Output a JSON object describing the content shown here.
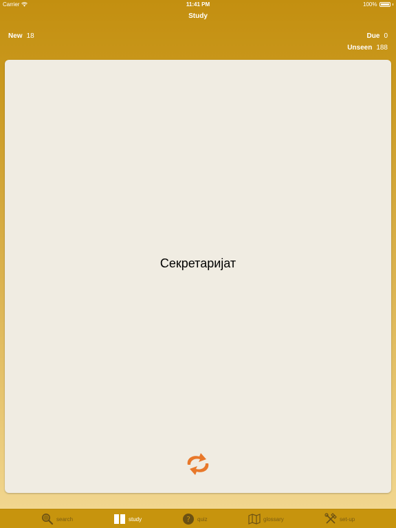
{
  "status_bar": {
    "carrier": "Carrier",
    "time": "11:41 PM",
    "battery": "100%",
    "battery_level": 1.0
  },
  "nav": {
    "title": "Study"
  },
  "stats": {
    "new_label": "New",
    "new_value": "18",
    "due_label": "Due",
    "due_value": "0",
    "unseen_label": "Unseen",
    "unseen_value": "188"
  },
  "card": {
    "word": "Секретаријат",
    "flip_icon": "refresh-icon",
    "accent": "#e8782a"
  },
  "tabs": [
    {
      "label": "search",
      "icon": "search-icon"
    },
    {
      "label": "study",
      "icon": "book-icon",
      "active": true
    },
    {
      "label": "quiz",
      "icon": "question-icon"
    },
    {
      "label": "glossary",
      "icon": "map-icon"
    },
    {
      "label": "set-up",
      "icon": "tools-icon"
    }
  ],
  "colors": {
    "bar": "#c7940d",
    "card": "#f0ece2",
    "tab_inactive": "#7a5c14",
    "tab_active": "#ffffff"
  }
}
